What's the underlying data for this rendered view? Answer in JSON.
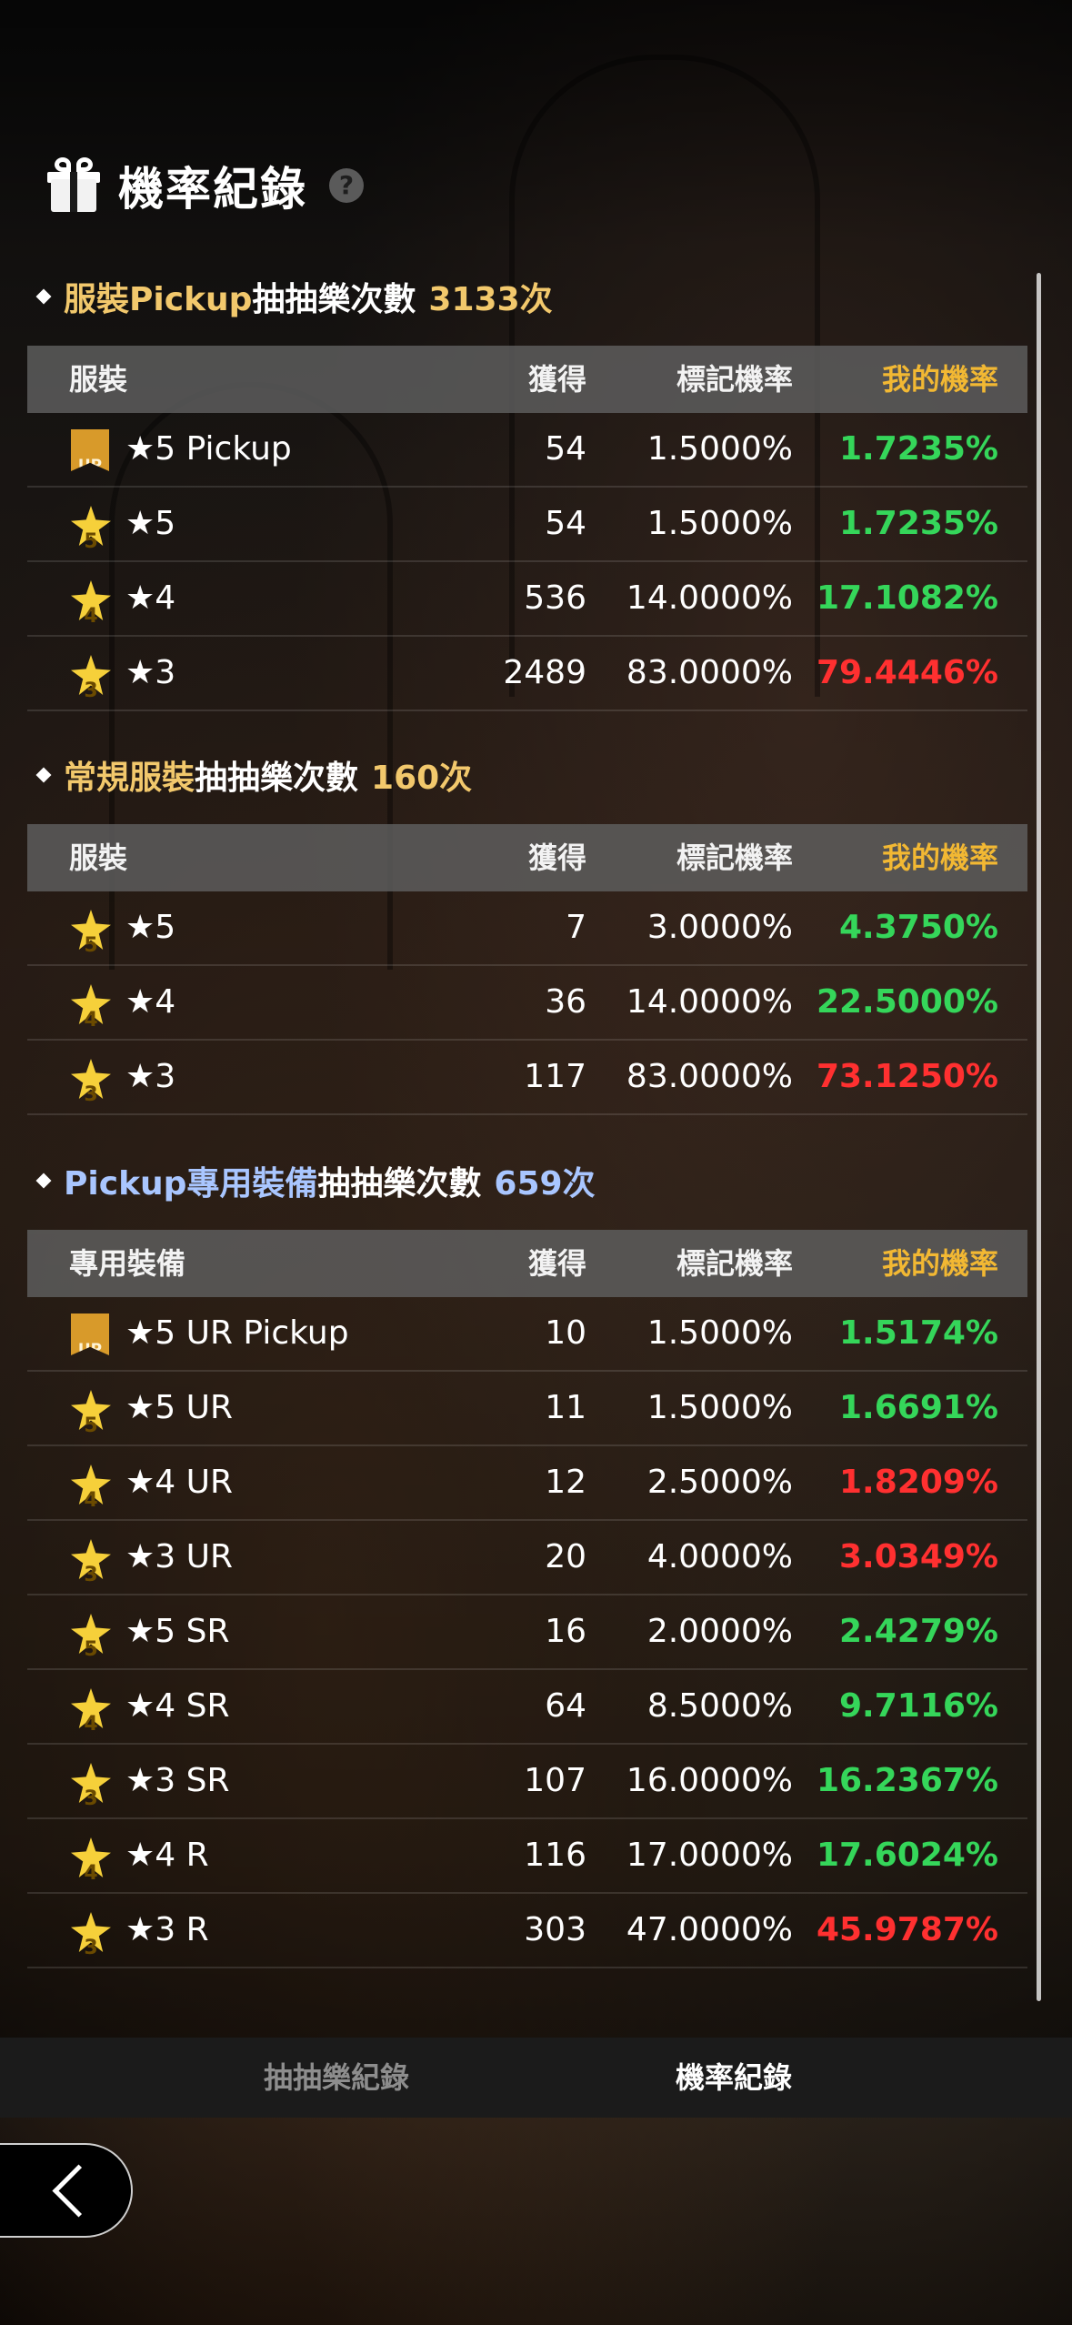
{
  "header": {
    "title": "機率紀錄",
    "help": "?"
  },
  "columns": {
    "got": "獲得",
    "rate": "標記機率",
    "mine": "我的機率"
  },
  "sections": [
    {
      "prefix": "服裝Pickup",
      "suffix": "抽抽樂次數",
      "count": "3133次",
      "prefix_color": "gold",
      "name_header": "服裝",
      "rows": [
        {
          "badge": "UP",
          "label": "★5 Pickup",
          "got": "54",
          "rate": "1.5000%",
          "mine": "1.7235%",
          "mine_color": "green"
        },
        {
          "badge": "5",
          "label": "★5",
          "got": "54",
          "rate": "1.5000%",
          "mine": "1.7235%",
          "mine_color": "green"
        },
        {
          "badge": "4",
          "label": "★4",
          "got": "536",
          "rate": "14.0000%",
          "mine": "17.1082%",
          "mine_color": "green"
        },
        {
          "badge": "3",
          "label": "★3",
          "got": "2489",
          "rate": "83.0000%",
          "mine": "79.4446%",
          "mine_color": "red"
        }
      ]
    },
    {
      "prefix": "常規服裝",
      "suffix": "抽抽樂次數",
      "count": "160次",
      "prefix_color": "gold",
      "name_header": "服裝",
      "rows": [
        {
          "badge": "5",
          "label": "★5",
          "got": "7",
          "rate": "3.0000%",
          "mine": "4.3750%",
          "mine_color": "green"
        },
        {
          "badge": "4",
          "label": "★4",
          "got": "36",
          "rate": "14.0000%",
          "mine": "22.5000%",
          "mine_color": "green"
        },
        {
          "badge": "3",
          "label": "★3",
          "got": "117",
          "rate": "83.0000%",
          "mine": "73.1250%",
          "mine_color": "red"
        }
      ]
    },
    {
      "prefix": "Pickup專用裝備",
      "suffix": "抽抽樂次數",
      "count": "659次",
      "prefix_color": "blue",
      "name_header": "專用裝備",
      "rows": [
        {
          "badge": "UP",
          "label": "★5 UR Pickup",
          "got": "10",
          "rate": "1.5000%",
          "mine": "1.5174%",
          "mine_color": "green"
        },
        {
          "badge": "5",
          "label": "★5 UR",
          "got": "11",
          "rate": "1.5000%",
          "mine": "1.6691%",
          "mine_color": "green"
        },
        {
          "badge": "4",
          "label": "★4 UR",
          "got": "12",
          "rate": "2.5000%",
          "mine": "1.8209%",
          "mine_color": "red"
        },
        {
          "badge": "3",
          "label": "★3 UR",
          "got": "20",
          "rate": "4.0000%",
          "mine": "3.0349%",
          "mine_color": "red"
        },
        {
          "badge": "5",
          "label": "★5 SR",
          "got": "16",
          "rate": "2.0000%",
          "mine": "2.4279%",
          "mine_color": "green"
        },
        {
          "badge": "4",
          "label": "★4 SR",
          "got": "64",
          "rate": "8.5000%",
          "mine": "9.7116%",
          "mine_color": "green"
        },
        {
          "badge": "3",
          "label": "★3 SR",
          "got": "107",
          "rate": "16.0000%",
          "mine": "16.2367%",
          "mine_color": "green"
        },
        {
          "badge": "4",
          "label": "★4 R",
          "got": "116",
          "rate": "17.0000%",
          "mine": "17.6024%",
          "mine_color": "green"
        },
        {
          "badge": "3",
          "label": "★3 R",
          "got": "303",
          "rate": "47.0000%",
          "mine": "45.9787%",
          "mine_color": "red"
        }
      ]
    }
  ],
  "tabs": {
    "history": "抽抽樂紀錄",
    "rate": "機率紀錄"
  },
  "colors": {
    "gold": "#f2c86c",
    "blue": "#a9c6ff",
    "green": "#35d65a",
    "red": "#ff3030",
    "header_accent": "#f2b833"
  }
}
